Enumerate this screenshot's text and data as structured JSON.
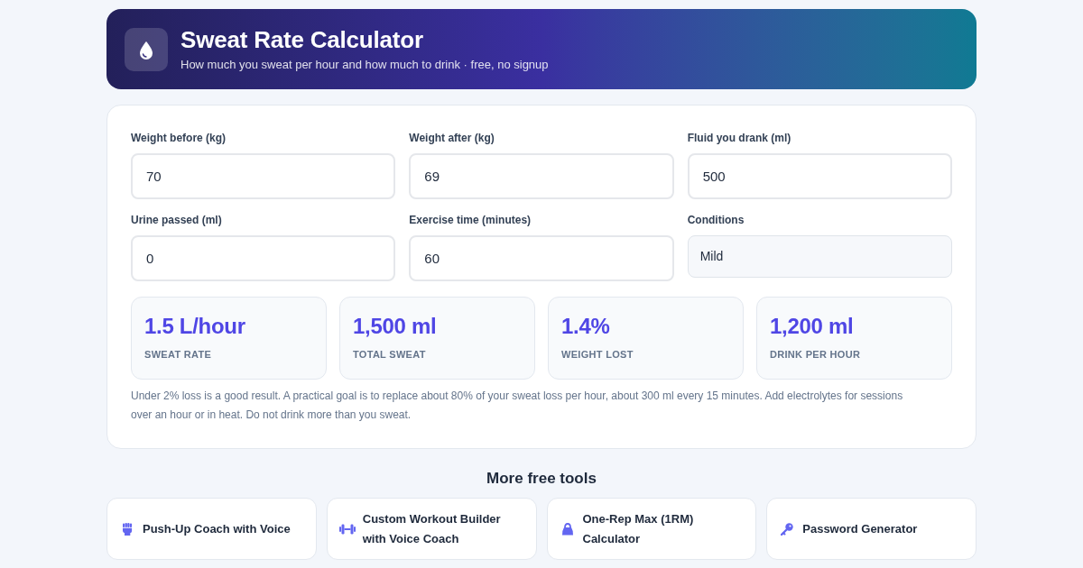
{
  "header": {
    "title": "Sweat Rate Calculator",
    "subtitle": "How much you sweat per hour and how much to drink · free, no signup"
  },
  "fields": [
    {
      "kind": "input",
      "label": "Weight before (kg)",
      "value": "70"
    },
    {
      "kind": "input",
      "label": "Weight after (kg)",
      "value": "69"
    },
    {
      "kind": "input",
      "label": "Fluid you drank (ml)",
      "value": "500"
    },
    {
      "kind": "input",
      "label": "Urine passed (ml)",
      "value": "0"
    },
    {
      "kind": "input",
      "label": "Exercise time (minutes)",
      "value": "60"
    },
    {
      "kind": "select",
      "label": "Conditions",
      "value": "Mild"
    }
  ],
  "results": [
    {
      "value": "1.5 L/hour",
      "label": "SWEAT RATE"
    },
    {
      "value": "1,500 ml",
      "label": "TOTAL SWEAT"
    },
    {
      "value": "1.4%",
      "label": "WEIGHT LOST"
    },
    {
      "value": "1,200 ml",
      "label": "DRINK PER HOUR"
    }
  ],
  "note": "Under 2% loss is a good result. A practical goal is to replace about 80% of your sweat loss per hour, about 300 ml every 15 minutes. Add electrolytes for sessions over an hour or in heat. Do not drink more than you sweat.",
  "more_tools": {
    "heading": "More free tools",
    "items": [
      {
        "label": "Push-Up Coach with Voice"
      },
      {
        "label": "Custom Workout Builder with Voice Coach"
      },
      {
        "label": "One-Rep Max (1RM) Calculator"
      },
      {
        "label": "Password Generator"
      }
    ]
  }
}
